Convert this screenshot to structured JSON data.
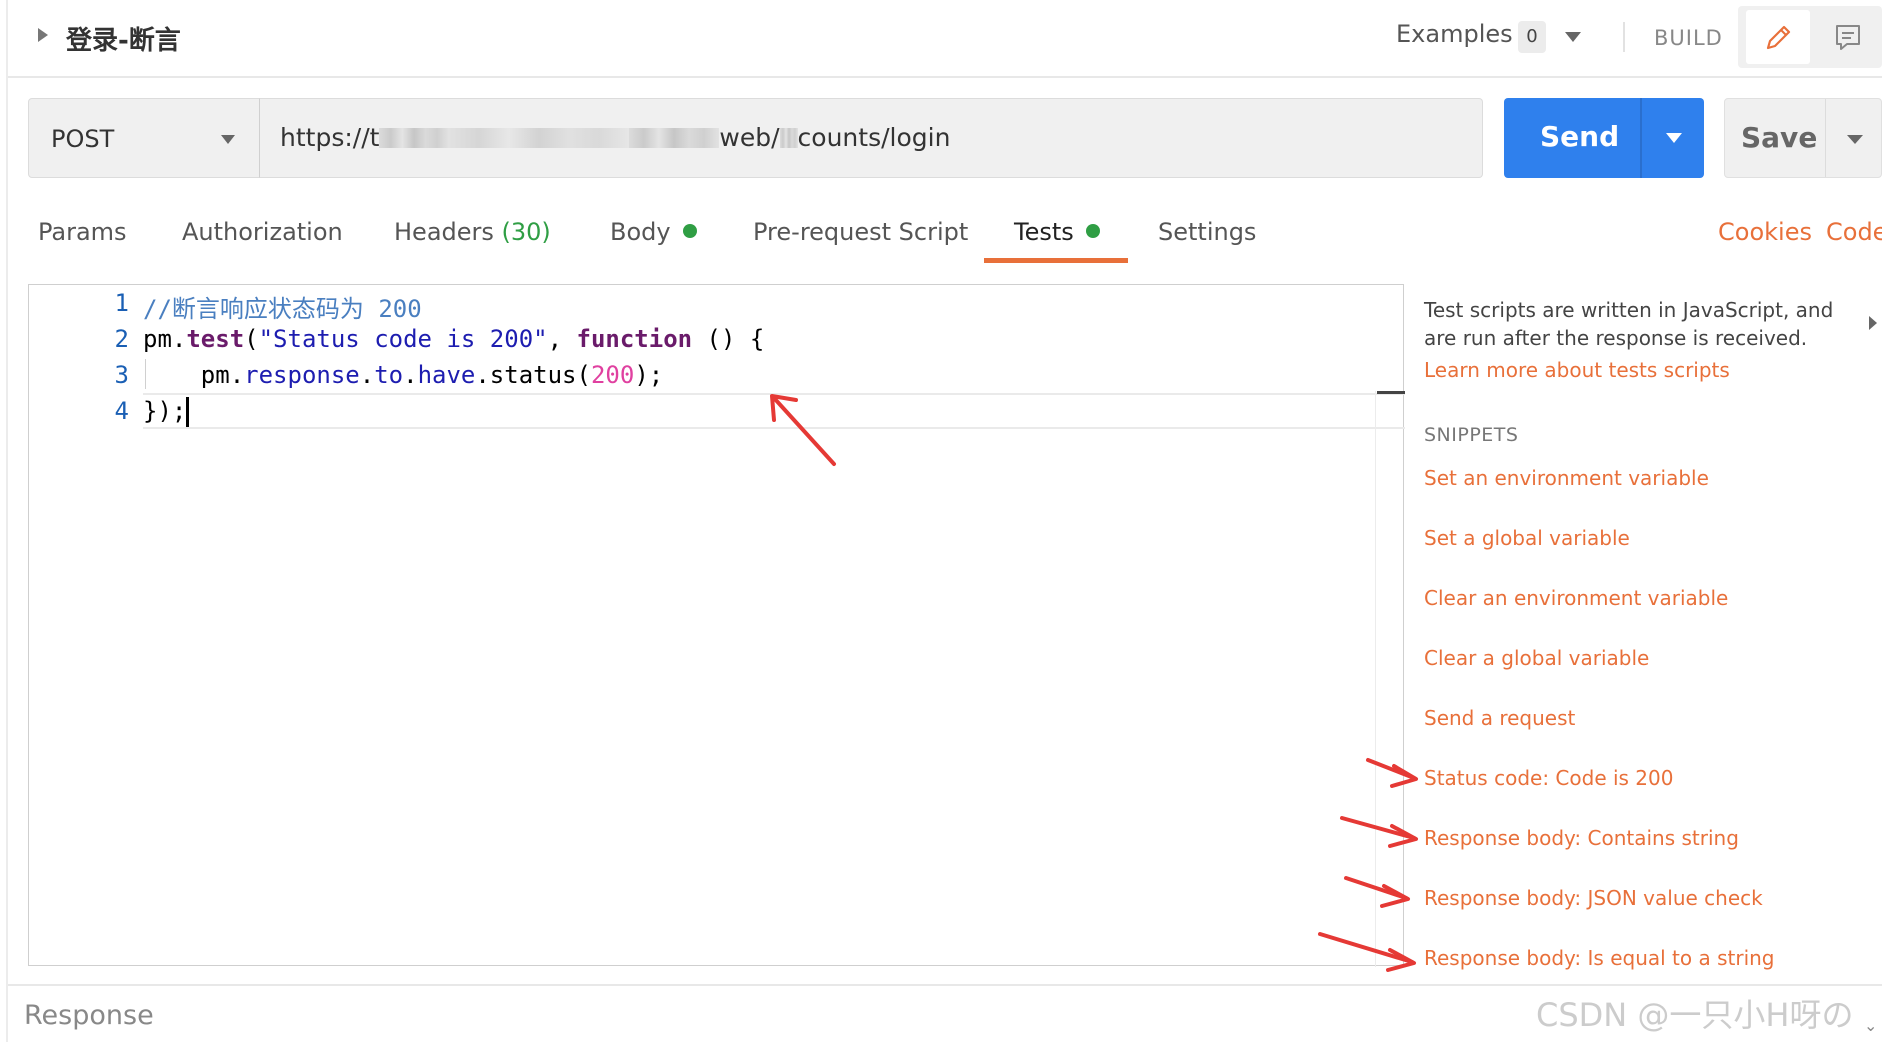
{
  "header": {
    "title": "登录-断言",
    "examples_label": "Examples",
    "examples_count": "0",
    "build_label": "BUILD"
  },
  "request": {
    "method": "POST",
    "url_prefix": "https://t",
    "url_mid": "web/",
    "url_suffix": "counts/login",
    "send_label": "Send",
    "save_label": "Save"
  },
  "tabs": [
    {
      "label": "Params"
    },
    {
      "label": "Authorization"
    },
    {
      "label": "Headers",
      "count": "(30)"
    },
    {
      "label": "Body"
    },
    {
      "label": "Pre-request Script"
    },
    {
      "label": "Tests"
    },
    {
      "label": "Settings"
    }
  ],
  "right_links": {
    "cookies": "Cookies",
    "code": "Code"
  },
  "editor": {
    "line_numbers": [
      "1",
      "2",
      "3",
      "4"
    ],
    "line1_comment": "//断言响应状态码为 200",
    "line2_pm": "pm.",
    "line2_test": "test",
    "line2_paren": "(",
    "line2_str": "\"Status code is 200\"",
    "line2_comma": ", ",
    "line2_function": "function",
    "line2_tail": " () {",
    "line3_indent": "    ",
    "line3_pm": "pm.",
    "line3_response": "response",
    "line3_dot1": ".",
    "line3_to": "to",
    "line3_dot2": ".",
    "line3_have": "have",
    "line3_status": ".status(",
    "line3_num": "200",
    "line3_end": ");",
    "line4": "});"
  },
  "sidebar": {
    "description": "Test scripts are written in JavaScript, and are run after the response is received.",
    "learn_more": "Learn more about tests scripts",
    "snippets_heading": "SNIPPETS",
    "snippets": [
      "Set an environment variable",
      "Set a global variable",
      "Clear an environment variable",
      "Clear a global variable",
      "Send a request",
      "Status code: Code is 200",
      "Response body: Contains string",
      "Response body: JSON value check",
      "Response body: Is equal to a string"
    ]
  },
  "response_label": "Response",
  "watermark": "CSDN @一只小H呀の",
  "colors": {
    "accent_orange": "#e8703a",
    "send_blue": "#2f80ed",
    "status_green": "#2f9e44",
    "annotation_red": "#e53935"
  },
  "icons": [
    "pencil-icon",
    "comment-icon",
    "chevron-down-icon",
    "caret-right-icon"
  ]
}
